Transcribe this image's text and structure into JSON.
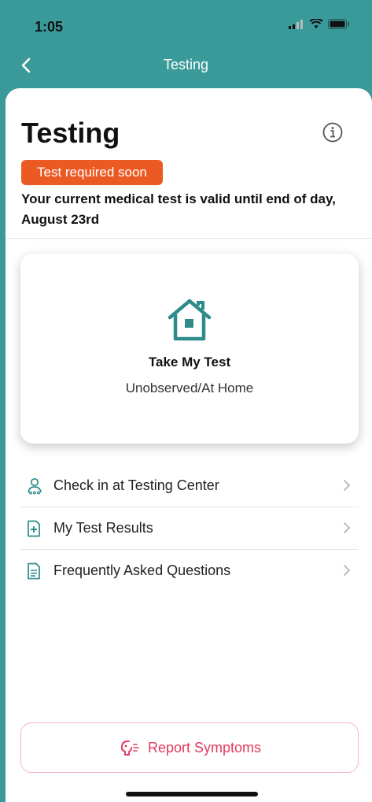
{
  "status": {
    "time": "1:05"
  },
  "nav": {
    "title": "Testing"
  },
  "page": {
    "title": "Testing",
    "badge": "Test required soon",
    "validity": "Your current medical test is valid until end of day, August 23rd"
  },
  "test_card": {
    "title": "Take My Test",
    "subtitle": "Unobserved/At Home"
  },
  "menu": [
    {
      "label": "Check in at Testing Center",
      "icon": "person-group-icon"
    },
    {
      "label": "My Test Results",
      "icon": "document-plus-icon"
    },
    {
      "label": "Frequently Asked Questions",
      "icon": "document-lines-icon"
    }
  ],
  "report": {
    "label": "Report Symptoms",
    "icon": "cough-icon"
  },
  "colors": {
    "header": "#3a9a99",
    "accent": "#2e8b8a",
    "badge": "#ec5a23",
    "report": "#e13a5f"
  }
}
